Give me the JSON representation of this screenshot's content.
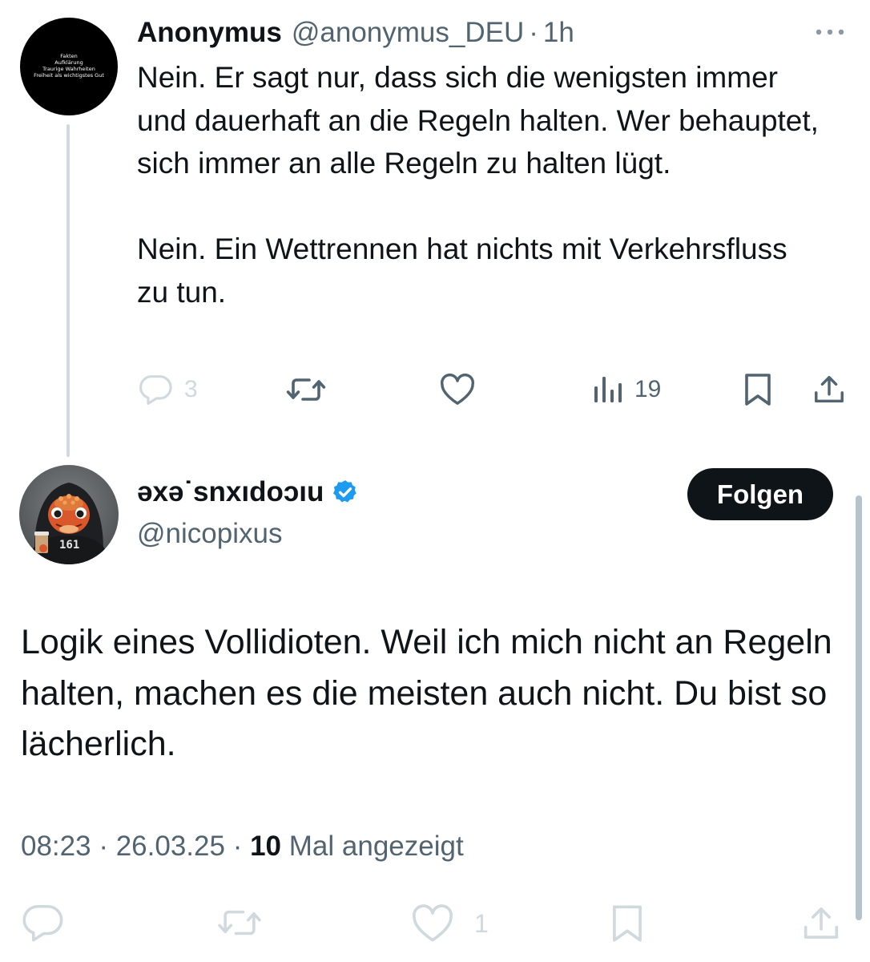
{
  "reply_tweet": {
    "avatar_lines": [
      "Fakten",
      "Aufklärung",
      "Traurige Wahrheiten",
      "Freiheit als wichtigstes Gut"
    ],
    "display_name": "Anonymus",
    "handle": "@anonymus_DEU",
    "separator": "·",
    "time": "1h",
    "more_icon": "ellipsis-icon",
    "paragraphs": [
      "Nein. Er sagt nur, dass sich die wenigsten immer und dauerhaft an die Regeln halten. Wer behauptet, sich immer an alle Regeln zu halten lügt.",
      "Nein. Ein Wettrennen hat nichts mit Verkehrsfluss zu tun."
    ],
    "actions": {
      "reply_count": "3",
      "views_count": "19"
    }
  },
  "main_tweet": {
    "display_name": "əxə˙snxıdoɔıu",
    "verified_icon": "verified-badge-icon",
    "verified_color": "#1d9bf0",
    "handle": "@nicopixus",
    "follow_label": "Folgen",
    "avatar_shirt_text": "161",
    "text": "Logik eines Vollidioten. Weil ich mich nicht an Regeln halten, machen es die meisten auch nicht. Du bist so lächerlich.",
    "time": "08:23",
    "date": "26.03.25",
    "views_count": "10",
    "views_label": "Mal angezeigt",
    "like_count": "1"
  },
  "colors": {
    "text": "#0f1419",
    "secondary": "#536471",
    "reply_icon_muted": "#cfd9de",
    "thread_line": "#cfd9de"
  }
}
